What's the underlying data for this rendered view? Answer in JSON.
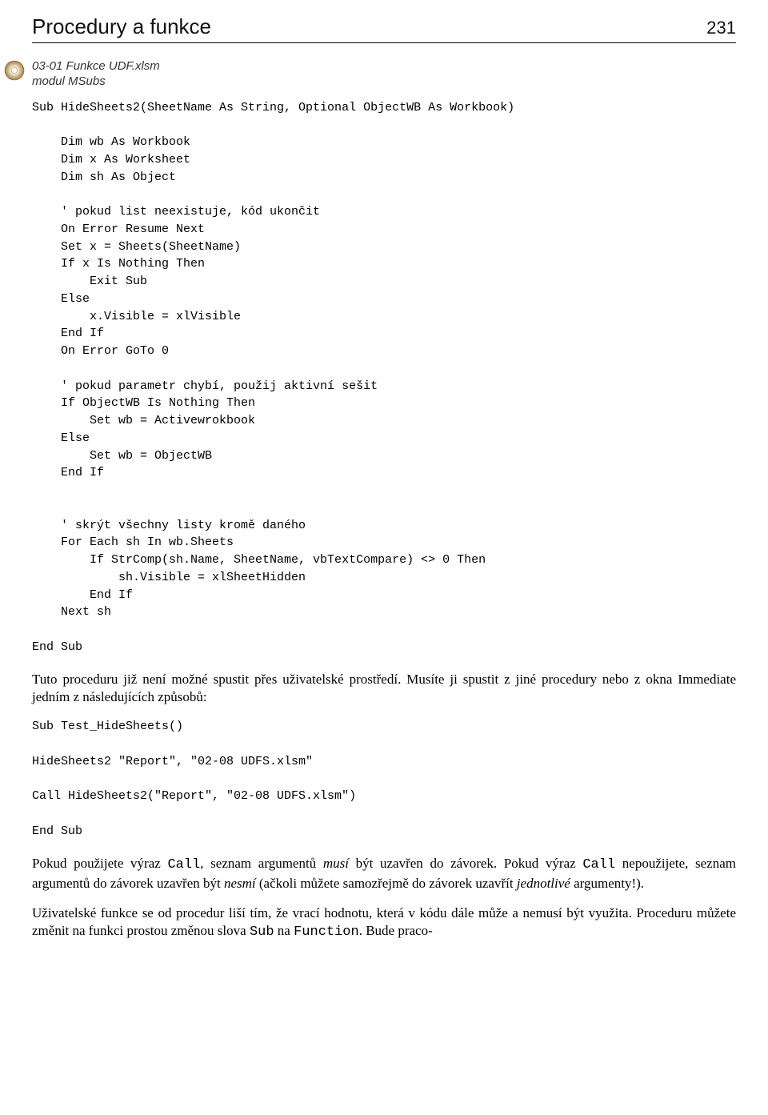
{
  "header": {
    "title": "Procedury a funkce",
    "page_number": "231"
  },
  "file_meta": {
    "line1": "03-01 Funkce UDF.xlsm",
    "line2": "modul MSubs"
  },
  "code1": "Sub HideSheets2(SheetName As String, Optional ObjectWB As Workbook)\n\n    Dim wb As Workbook\n    Dim x As Worksheet\n    Dim sh As Object\n\n    ' pokud list neexistuje, kód ukončit\n    On Error Resume Next\n    Set x = Sheets(SheetName)\n    If x Is Nothing Then\n        Exit Sub\n    Else\n        x.Visible = xlVisible\n    End If\n    On Error GoTo 0\n\n    ' pokud parametr chybí, použij aktivní sešit\n    If ObjectWB Is Nothing Then\n        Set wb = Activewrokbook\n    Else\n        Set wb = ObjectWB\n    End If\n\n\n    ' skrýt všechny listy kromě daného\n    For Each sh In wb.Sheets\n        If StrComp(sh.Name, SheetName, vbTextCompare) <> 0 Then\n            sh.Visible = xlSheetHidden\n        End If\n    Next sh\n\nEnd Sub",
  "para1": "Tuto proceduru již není možné spustit přes uživatelské prostředí. Musíte ji spustit z jiné procedury nebo z okna Immediate jedním z následujících způsobů:",
  "code2": "Sub Test_HideSheets()\n\nHideSheets2 \"Report\", \"02-08 UDFS.xlsm\"\n\nCall HideSheets2(\"Report\", \"02-08 UDFS.xlsm\")\n\nEnd Sub",
  "para2": {
    "pre": "Pokud použijete výraz ",
    "call1": "Call",
    "mid1": ", seznam argumentů ",
    "musi": "musí",
    "mid2": " být uzavřen do závorek. Pokud výraz ",
    "call2": "Call",
    "mid3": " nepoužijete, seznam argumentů do závorek uzavřen být ",
    "nesmi": "nesmí",
    "mid4": " (ačkoli můžete samozřejmě do závorek uzavřít ",
    "jednotlive": "jednotlivé",
    "end": " argumenty!)."
  },
  "para3": {
    "pre": "Uživatelské funkce se od procedur liší tím, že vrací hodnotu, která v kódu dále může a nemusí být využita. Proceduru můžete změnit na funkci prostou změnou slova ",
    "sub_word": "Sub",
    "mid": " na ",
    "func_word": "Function",
    "end": ". Bude praco-"
  }
}
